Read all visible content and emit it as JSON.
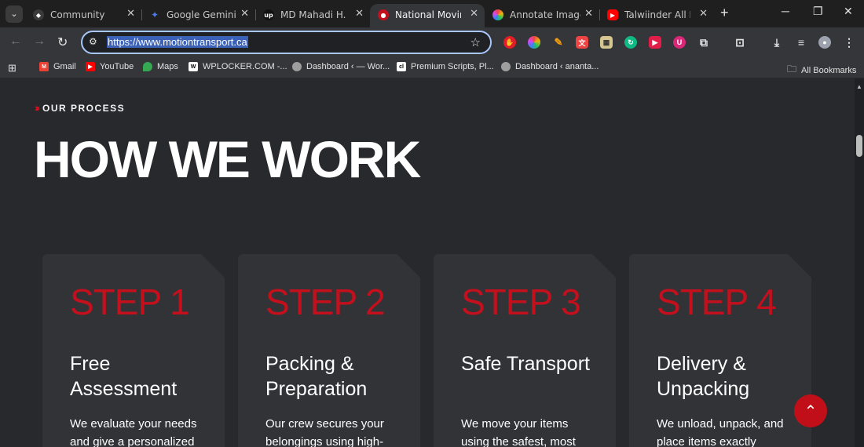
{
  "tabs": [
    {
      "title": "Community",
      "icon": "community-icon",
      "color": "#3a3a3a"
    },
    {
      "title": "Google Gemini",
      "icon": "gemini-icon",
      "color": "#4b7bec"
    },
    {
      "title": "MD Mahadi H. - W",
      "icon": "upwork-icon",
      "color": "#111111"
    },
    {
      "title": "National Moving C",
      "icon": "motion-icon",
      "color": "#c4101c"
    },
    {
      "title": "Annotate Image",
      "icon": "annotate-icon",
      "color": "#d946ef"
    },
    {
      "title": "Talwiinder All Hit S",
      "icon": "youtube-icon",
      "color": "#ff0000"
    }
  ],
  "toolbar": {
    "url": "https://www.motiontransport.ca"
  },
  "bookmarks": [
    {
      "label": "Gmail",
      "color": "#ea4335"
    },
    {
      "label": "YouTube",
      "color": "#ff0000"
    },
    {
      "label": "Maps",
      "color": "#34a853"
    },
    {
      "label": "WPLOCKER.COM -...",
      "color": "#ffffff"
    },
    {
      "label": "Dashboard ‹ — Wor...",
      "color": "#9e9e9e"
    },
    {
      "label": "Premium Scripts, Pl...",
      "color": "#ffffff"
    },
    {
      "label": "Dashboard ‹ ananta...",
      "color": "#9e9e9e"
    }
  ],
  "all_bookmarks": "All Bookmarks",
  "section": {
    "eyebrow": "OUR PROCESS",
    "headline": "HOW WE WORK"
  },
  "steps": [
    {
      "step": "STEP 1",
      "title": "Free Assessment",
      "desc": "We evaluate your needs and give a personalized"
    },
    {
      "step": "STEP 2",
      "title": "Packing & Preparation",
      "desc": "Our crew secures your belongings using high-"
    },
    {
      "step": "STEP 3",
      "title": "Safe Transport",
      "desc": "We move your items using the safest, most"
    },
    {
      "step": "STEP 4",
      "title": "Delivery & Unpacking",
      "desc": "We unload, unpack, and place items exactly"
    }
  ],
  "colors": {
    "accent": "#c4101c",
    "page_bg": "#28292d",
    "card_bg": "#323337"
  }
}
